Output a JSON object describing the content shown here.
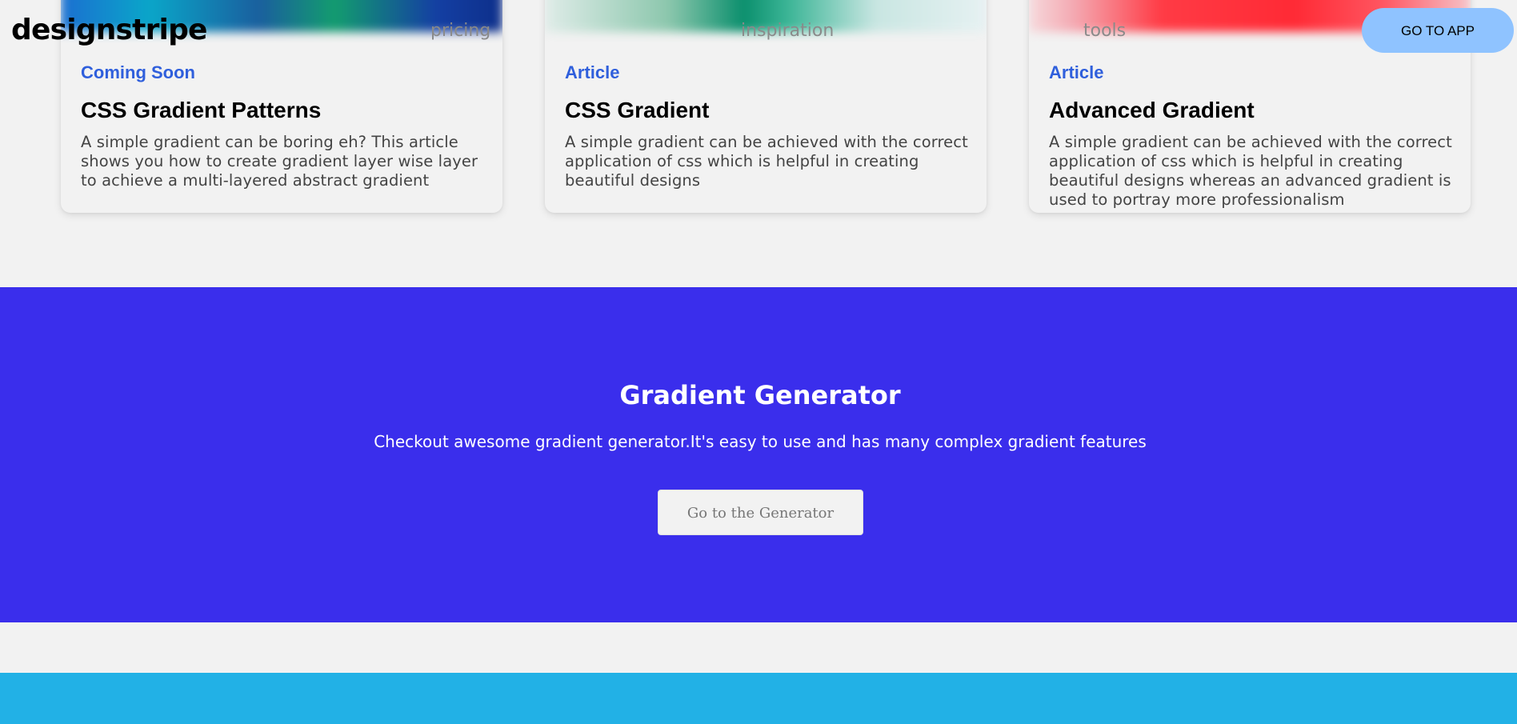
{
  "header": {
    "logo": "designstripe",
    "nav": [
      "pricing",
      "inspiration",
      "tools"
    ],
    "cta_label": "GO TO APP"
  },
  "cards": [
    {
      "tag": "Coming Soon",
      "title": "CSS Gradient Patterns",
      "description": "A simple gradient can be boring eh? This article shows you how to create gradient layer wise layer to achieve a multi-layered abstract gradient"
    },
    {
      "tag": "Article",
      "title": "CSS Gradient",
      "description": "A simple gradient can be achieved with the correct application of css which is helpful in creating beautiful designs"
    },
    {
      "tag": "Article",
      "title": "Advanced Gradient",
      "description": "A simple gradient can be achieved with the correct application of css which is helpful in creating beautiful designs whereas an advanced gradient is used to portray more professionalism"
    }
  ],
  "generator": {
    "title": "Gradient Generator",
    "subtitle": "Checkout awesome gradient generator.It's easy to use and has many complex gradient features",
    "button_label": "Go to the Generator"
  },
  "colors": {
    "accent": "#3a2eec",
    "tag": "#2f5fdc",
    "cta": "#8fc3ff",
    "footer": "#22b1e6",
    "page_bg": "#f2f2f2"
  }
}
